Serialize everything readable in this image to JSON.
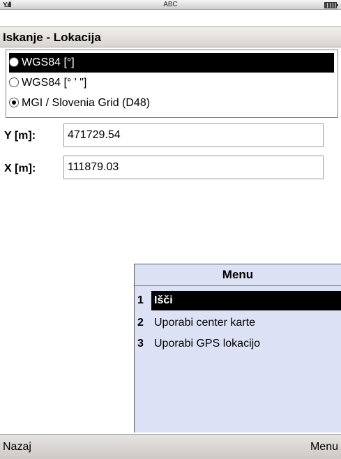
{
  "status_bar": {
    "signal_text": "Y.ıll",
    "input_mode": "ABC",
    "battery_icon": "battery-icon"
  },
  "title": "Iskanje - Lokacija",
  "coordinate_system": {
    "options": [
      {
        "label": "WGS84 [°]",
        "checked": false,
        "highlighted": true
      },
      {
        "label": "WGS84 [° ' \"]",
        "checked": false,
        "highlighted": false
      },
      {
        "label": "MGI / Slovenia Grid (D48)",
        "checked": true,
        "highlighted": false
      }
    ]
  },
  "fields": {
    "y": {
      "label": "Y [m]:",
      "value": "471729.54"
    },
    "x": {
      "label": "X [m]:",
      "value": "111879.03"
    }
  },
  "menu": {
    "title": "Menu",
    "items": [
      {
        "number": "1",
        "label": "Išči",
        "selected": true
      },
      {
        "number": "2",
        "label": "Uporabi center karte",
        "selected": false
      },
      {
        "number": "3",
        "label": "Uporabi GPS lokacijo",
        "selected": false
      }
    ]
  },
  "softkeys": {
    "left": "Nazaj",
    "right": "Menu"
  },
  "colors": {
    "menu_background": "#dde1f5",
    "selection": "#000000"
  }
}
